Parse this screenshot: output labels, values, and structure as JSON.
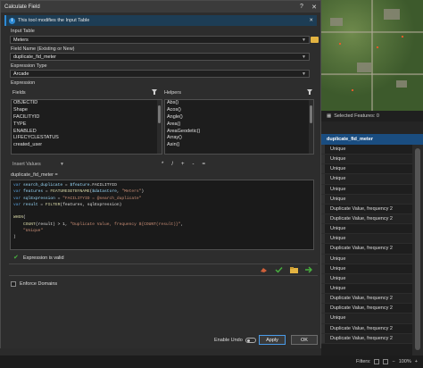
{
  "dialog": {
    "title": "Calculate Field",
    "info_message": "This tool modifies the Input Table",
    "input_table_label": "Input Table",
    "input_table_value": "Meters",
    "field_name_label": "Field Name (Existing or New)",
    "field_name_value": "duplicate_fid_meter",
    "expression_type_label": "Expression Type",
    "expression_type_value": "Arcade",
    "expression_label": "Expression",
    "fields_label": "Fields",
    "helpers_label": "Helpers",
    "fields": [
      "OBJECTID",
      "Shape",
      "FACILITYID",
      "TYPE",
      "ENABLED",
      "LIFECYCLESTATUS",
      "created_user"
    ],
    "helpers": [
      "Abs()",
      "Acos()",
      "Angle()",
      "Area()",
      "AreaGeodetic()",
      "Array()",
      "Asin()"
    ],
    "insert_values_label": "Insert Values",
    "operators": [
      "*",
      "/",
      "+",
      "-",
      "="
    ],
    "expression_target": "duplicate_fid_meter =",
    "code_lines": [
      "var search_duplicate = $feature.FACILITYID",
      "var features = FEATURESETBYNAME($datastore, \"Meters\")",
      "var sqlExpression = \"FACILITYID = @search_duplicate\"",
      "var result = FILTER(features, sqlExpression)",
      "",
      "WHEN(",
      "    COUNT(result) > 1, \"Duplicate Value, frequency ${COUNT(result)}\",",
      "    \"Unique\"",
      ")"
    ],
    "validation_message": "Expression is valid",
    "enforce_domains_label": "Enforce Domains",
    "enable_undo_label": "Enable Undo",
    "apply_label": "Apply",
    "ok_label": "OK"
  },
  "background": {
    "selected_features_label": "Selected Features: 0",
    "column_header": "duplicate_fid_meter",
    "rows": [
      "Unique",
      "Unique",
      "Unique",
      "Unique",
      "Unique",
      "Unique",
      "Duplicate Value, frequency 2",
      "Duplicate Value, frequency 2",
      "Unique",
      "Unique",
      "Duplicate Value, frequency 2",
      "Unique",
      "Unique",
      "Unique",
      "Unique",
      "Duplicate Value, frequency 2",
      "Duplicate Value, frequency 2",
      "Unique",
      "Duplicate Value, frequency 2",
      "Duplicate Value, frequency 2"
    ],
    "filters_label": "Filters:",
    "zoom_label": "100%"
  },
  "colors": {
    "accent": "#2e8bd6",
    "valid": "#48b13f",
    "header_row": "#1a4d80"
  }
}
